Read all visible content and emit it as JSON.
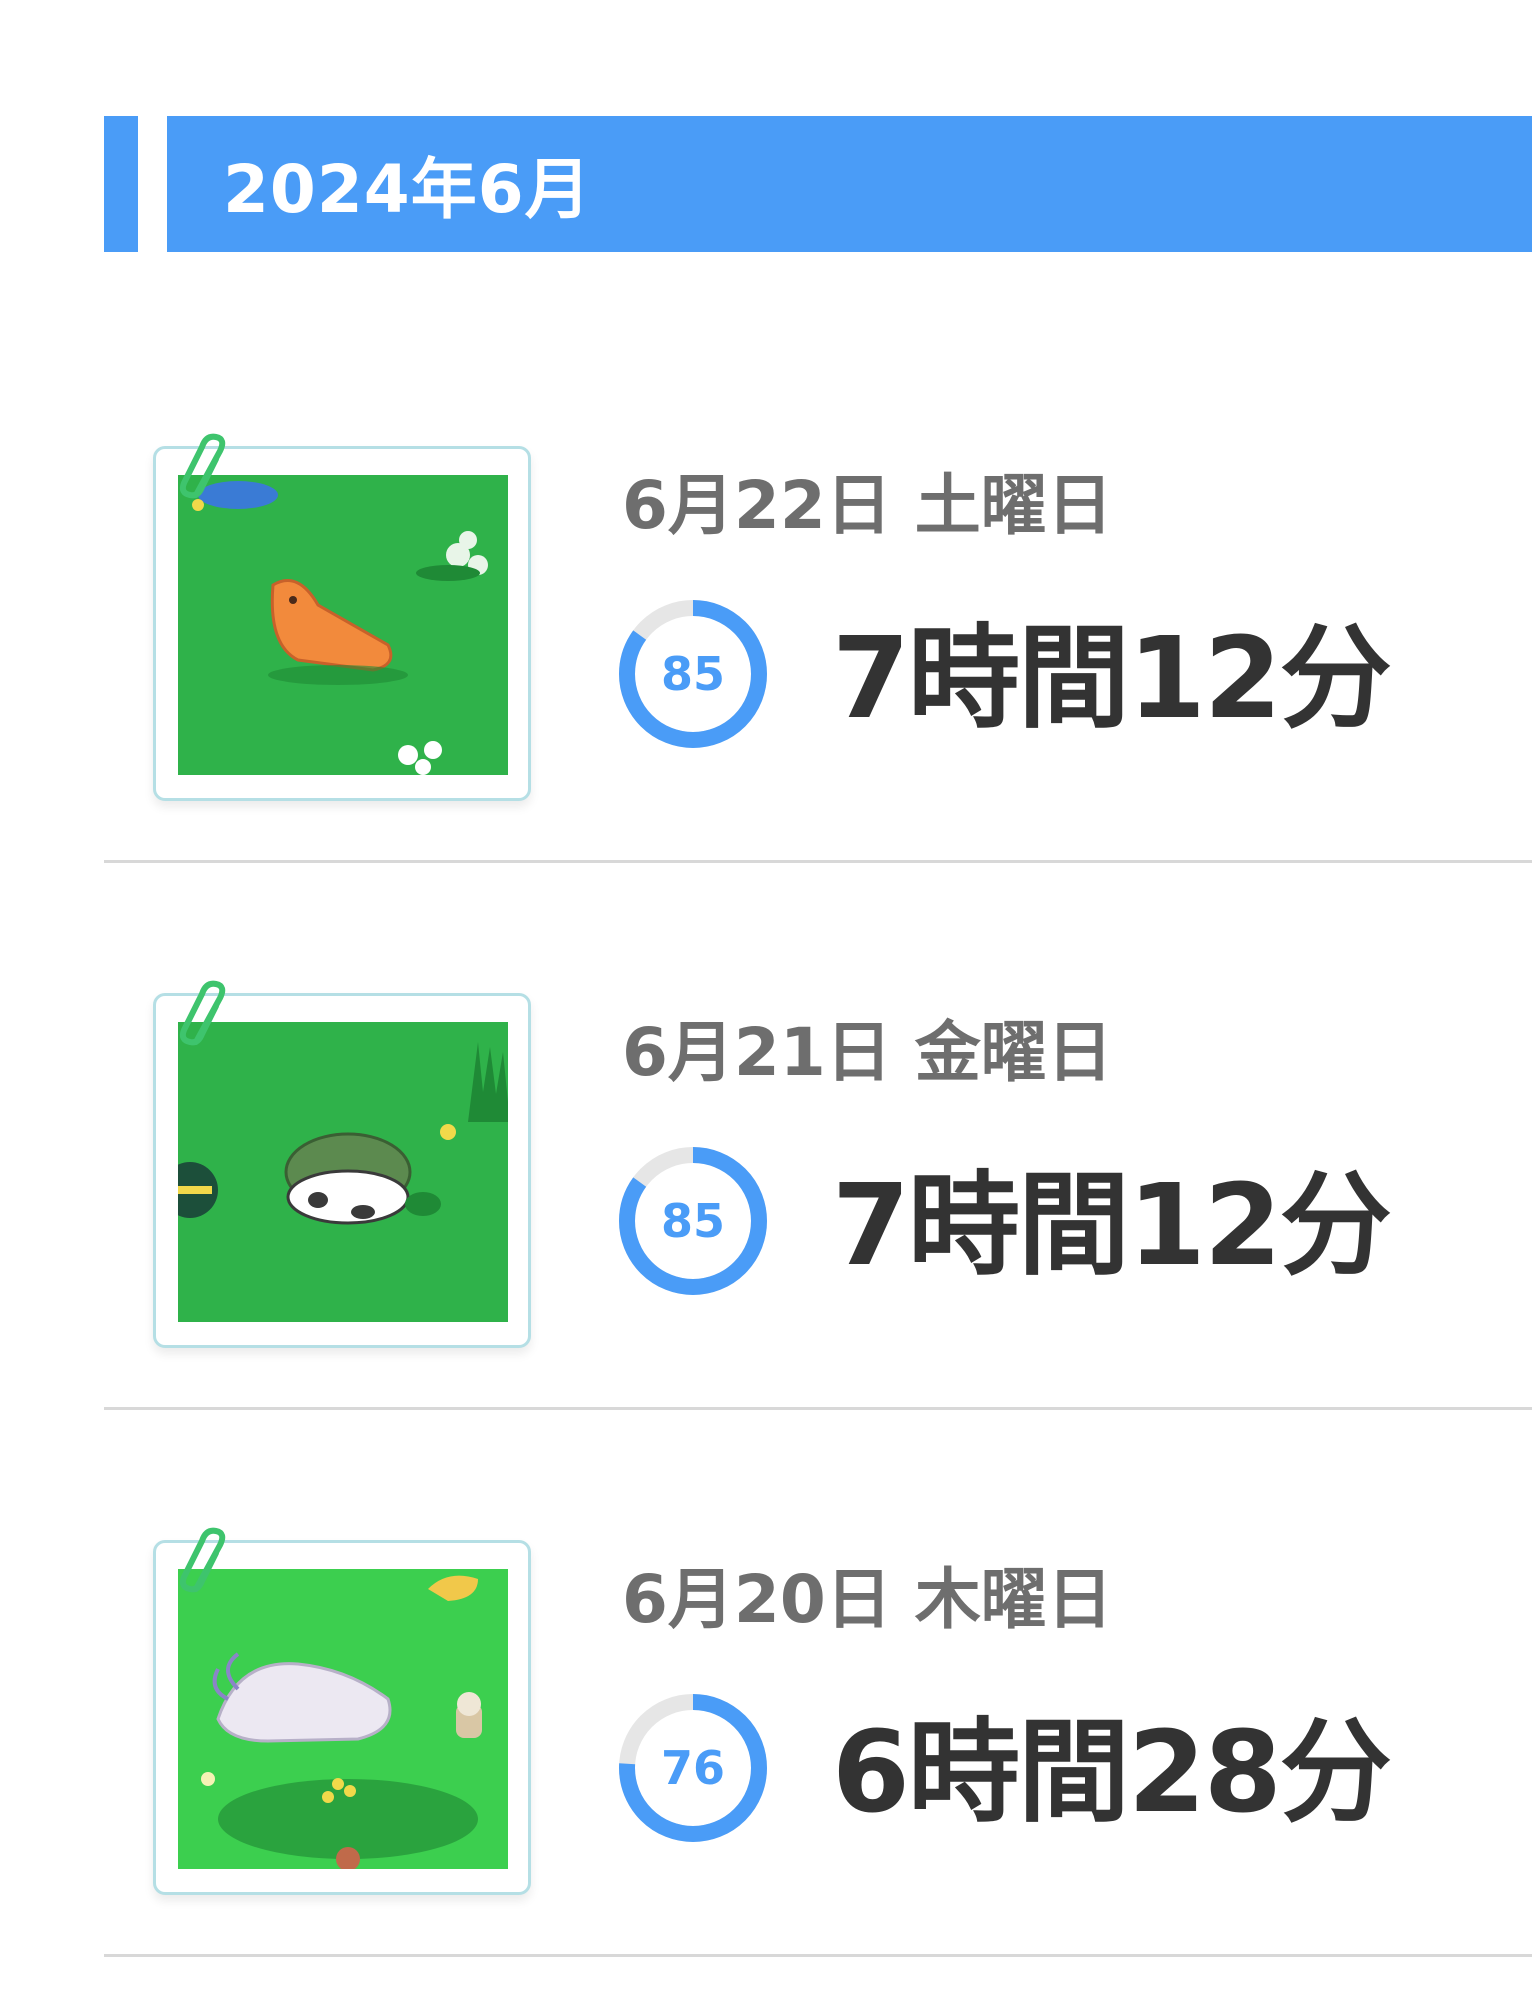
{
  "month": {
    "title": "2024年6月",
    "accent_color": "#4a9cf7"
  },
  "entries": [
    {
      "date": "6月22日 土曜日",
      "score": "85",
      "score_value": 85,
      "duration": "7時間12分",
      "thumb_icon": "sleeping-metapod-scene-icon"
    },
    {
      "date": "6月21日 金曜日",
      "score": "85",
      "score_value": 85,
      "duration": "7時間12分",
      "thumb_icon": "sleeping-shell-scene-icon"
    },
    {
      "date": "6月20日 木曜日",
      "score": "76",
      "score_value": 76,
      "duration": "6時間28分",
      "thumb_icon": "sleeping-ninetales-scene-icon"
    }
  ],
  "colors": {
    "ring_fill": "#4a9cf7",
    "ring_track": "#e6e6e6",
    "grass": "#2fb24a"
  }
}
